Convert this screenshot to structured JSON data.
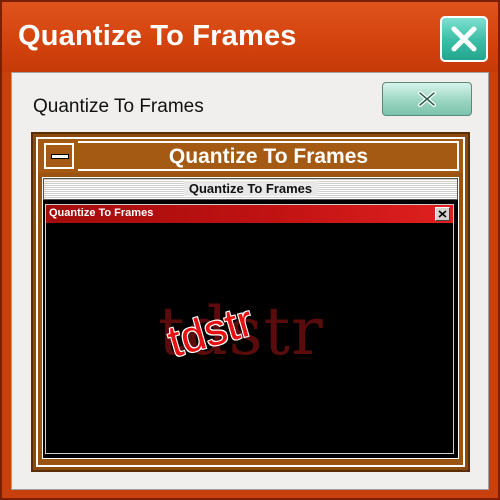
{
  "outer_window": {
    "title": "Quantize To Frames",
    "close_icon": "close-x-icon",
    "accent_color": "#d2420d",
    "close_color": "#3fbfa8"
  },
  "window2": {
    "title": "Quantize To Frames",
    "close_icon": "close-x-icon",
    "close_color": "#9ad6c2"
  },
  "window3": {
    "title": "Quantize To Frames",
    "minimize_icon": "minimize-bar-icon",
    "accent_color": "#a45a12"
  },
  "window4": {
    "title": "Quantize To Frames"
  },
  "window5": {
    "title": "Quantize To Frames",
    "close_icon": "close-x-icon",
    "accent_color": "#c01212"
  },
  "watermark": {
    "text": "tdstr",
    "color": "#e81010"
  }
}
